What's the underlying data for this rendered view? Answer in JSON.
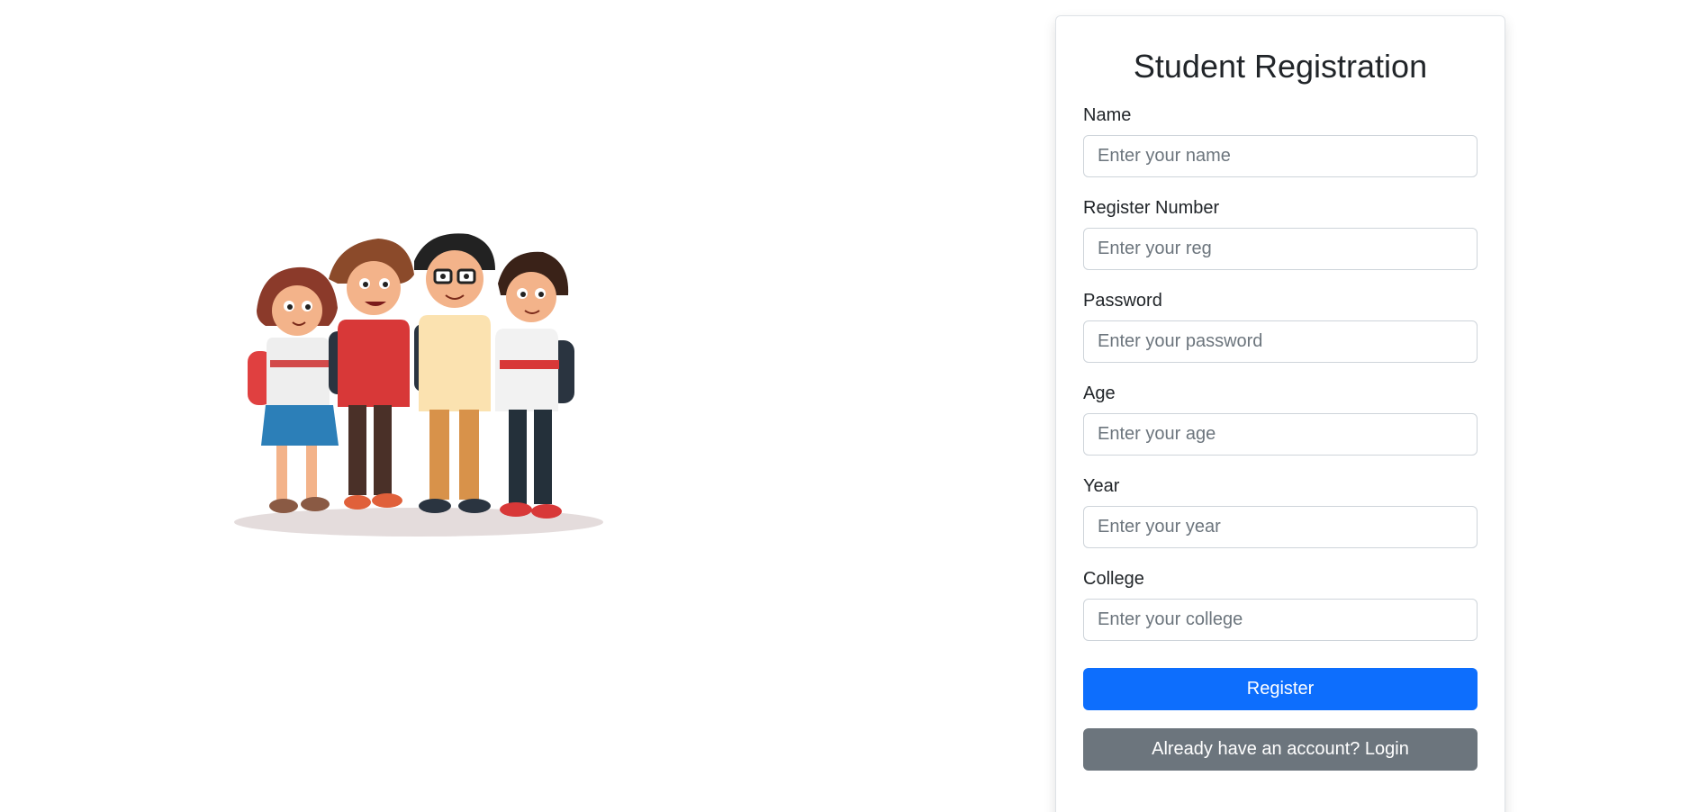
{
  "form": {
    "title": "Student Registration",
    "fields": [
      {
        "label": "Name",
        "placeholder": "Enter your name",
        "value": ""
      },
      {
        "label": "Register Number",
        "placeholder": "Enter your reg",
        "value": ""
      },
      {
        "label": "Password",
        "placeholder": "Enter your password",
        "value": ""
      },
      {
        "label": "Age",
        "placeholder": "Enter your age",
        "value": ""
      },
      {
        "label": "Year",
        "placeholder": "Enter your year",
        "value": ""
      },
      {
        "label": "College",
        "placeholder": "Enter your college",
        "value": ""
      }
    ],
    "register_label": "Register",
    "login_label": "Already have an account? Login"
  },
  "illustration": {
    "icon": "students-group-illustration"
  },
  "colors": {
    "primary": "#0d6efd",
    "secondary": "#6c757d",
    "border": "#ced4da"
  }
}
